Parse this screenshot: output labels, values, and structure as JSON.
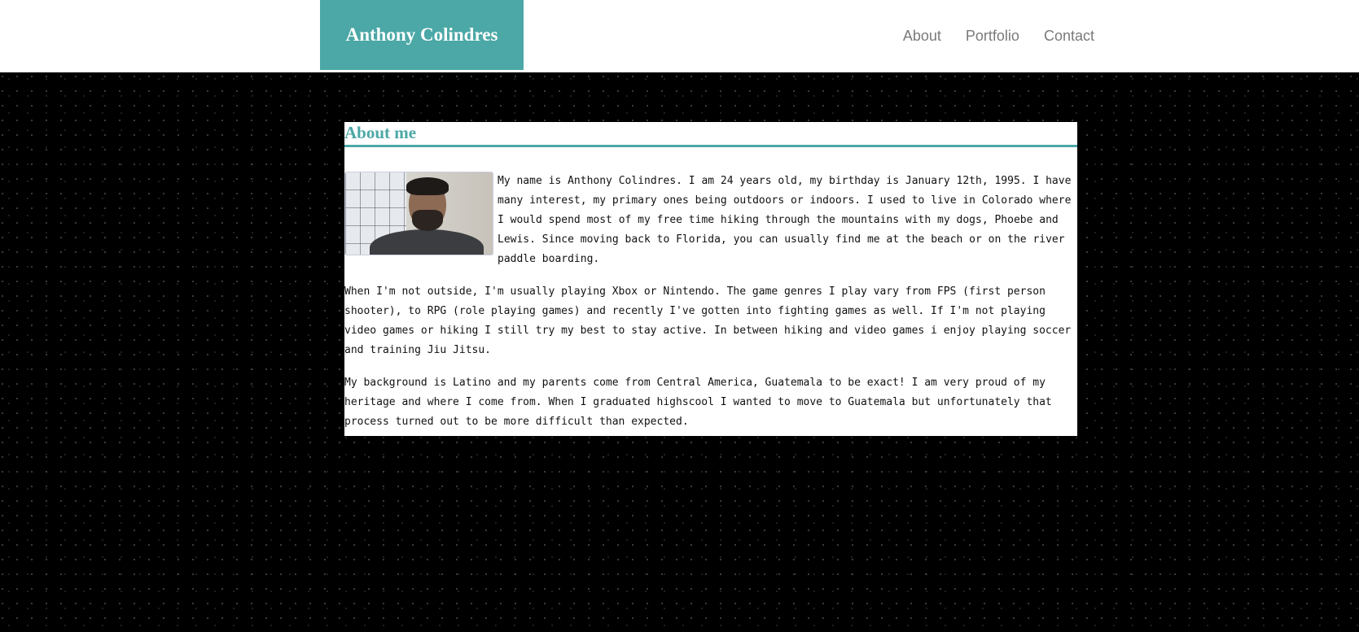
{
  "header": {
    "brand": "Anthony Colindres",
    "nav": [
      "About",
      "Portfolio",
      "Contact"
    ],
    "brand_color": "#4ba8a6"
  },
  "about": {
    "title": "About me",
    "photo_alt": "Anthony Colindres",
    "paragraphs": [
      "My name is Anthony Colindres. I am 24 years old, my birthday is January 12th, 1995. I have many interest, my primary ones being outdoors or indoors. I used to live in Colorado where I would spend most of my free time hiking through the mountains with my dogs, Phoebe and Lewis. Since moving back to Florida, you can usually find me at the beach or on the river paddle boarding.",
      "When I'm not outside, I'm usually playing Xbox or Nintendo. The game genres I play vary from FPS (first person shooter), to RPG (role playing games) and recently I've gotten into fighting games as well. If I'm not playing video games or hiking I still try my best to stay active. In between hiking and video games i enjoy playing soccer and training Jiu Jitsu.",
      "My background is Latino and my parents come from Central America, Guatemala to be exact! I am very proud of my heritage and where I come from. When I graduated highscool I wanted to move to Guatemala but unfortunately that process turned out to be more difficult than expected."
    ]
  }
}
